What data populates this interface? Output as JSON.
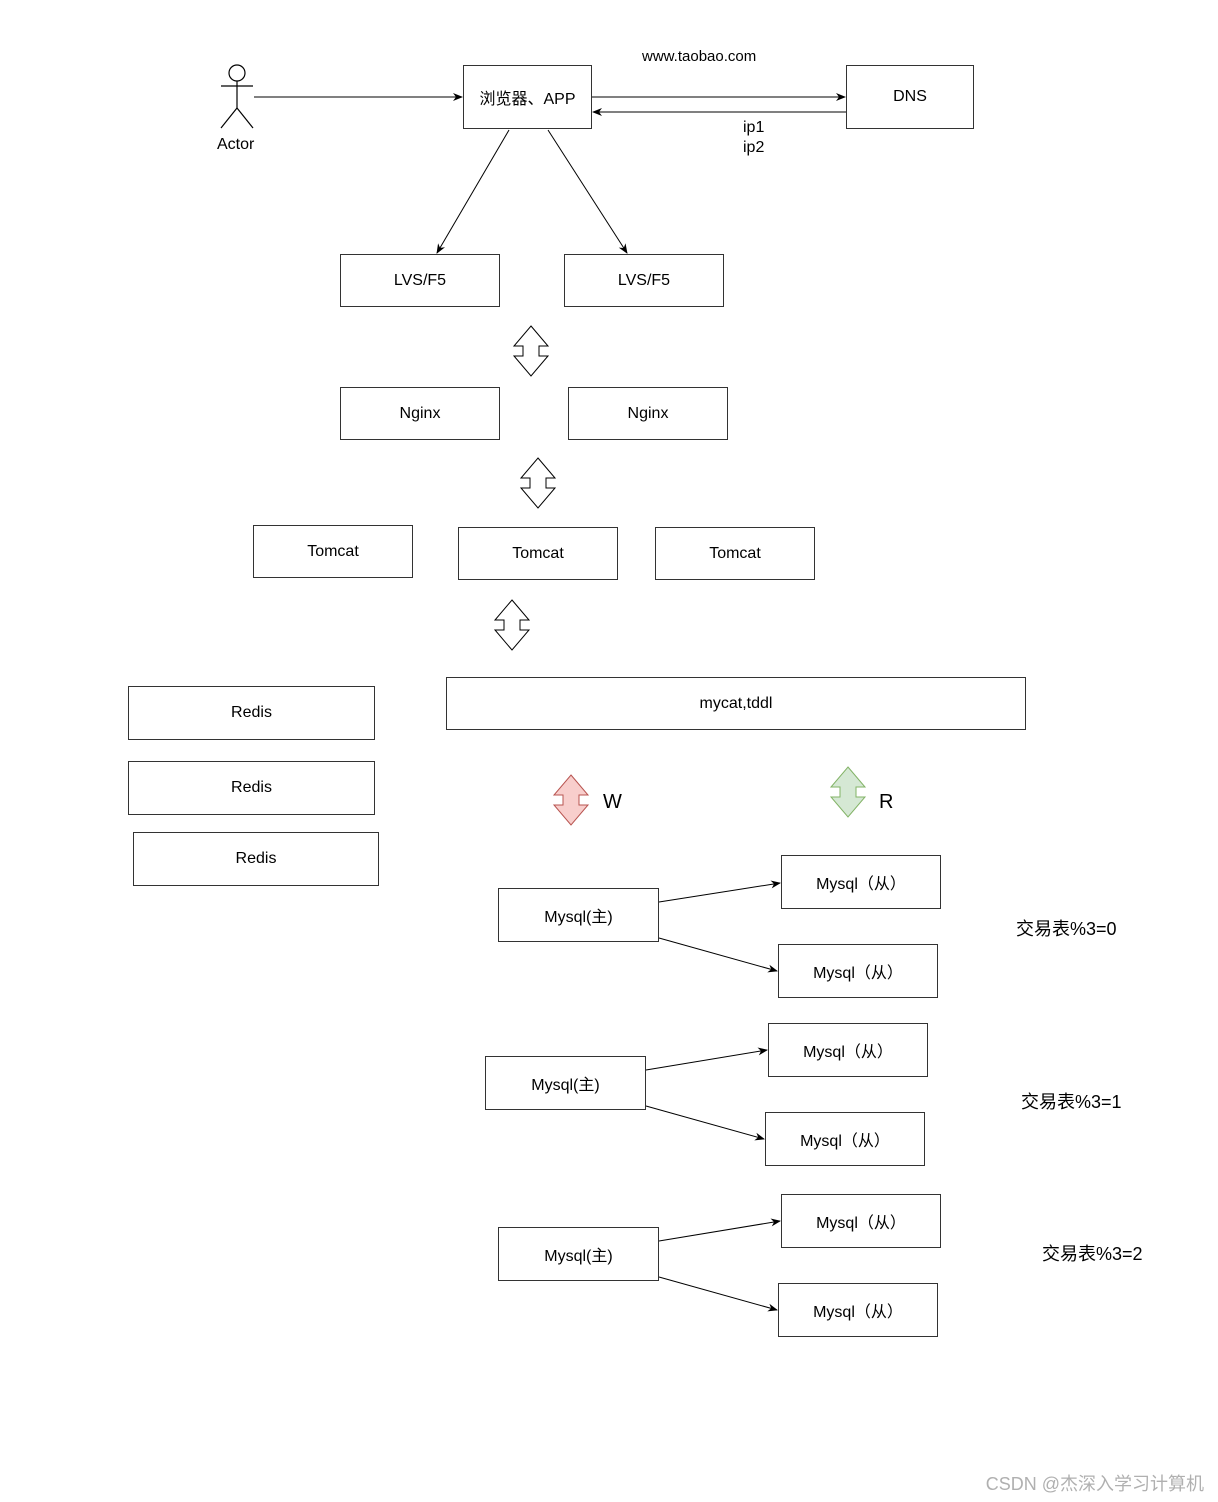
{
  "actor": {
    "label": "Actor"
  },
  "browser": {
    "label": "浏览器、APP"
  },
  "dns": {
    "label": "DNS",
    "url_label": "www.taobao.com",
    "ip_labels": [
      "ip1",
      "ip2"
    ]
  },
  "lvs": [
    {
      "label": "LVS/F5"
    },
    {
      "label": "LVS/F5"
    }
  ],
  "nginx": [
    {
      "label": "Nginx"
    },
    {
      "label": "Nginx"
    }
  ],
  "tomcat": [
    {
      "label": "Tomcat"
    },
    {
      "label": "Tomcat"
    },
    {
      "label": "Tomcat"
    }
  ],
  "redis": [
    {
      "label": "Redis"
    },
    {
      "label": "Redis"
    },
    {
      "label": "Redis"
    }
  ],
  "middleware": {
    "label": "mycat,tddl"
  },
  "write_label": "W",
  "read_label": "R",
  "colors": {
    "write_fill": "#f8cecc",
    "write_stroke": "#b85450",
    "read_fill": "#d5e8d4",
    "read_stroke": "#82b366"
  },
  "shards": [
    {
      "master": "Mysql(主)",
      "slaves": [
        "Mysql（从）",
        "Mysql（从）"
      ],
      "rule": "交易表%3=0"
    },
    {
      "master": "Mysql(主)",
      "slaves": [
        "Mysql（从）",
        "Mysql（从）"
      ],
      "rule": "交易表%3=1"
    },
    {
      "master": "Mysql(主)",
      "slaves": [
        "Mysql（从）",
        "Mysql（从）"
      ],
      "rule": "交易表%3=2"
    }
  ],
  "watermark": "CSDN @杰深入学习计算机"
}
